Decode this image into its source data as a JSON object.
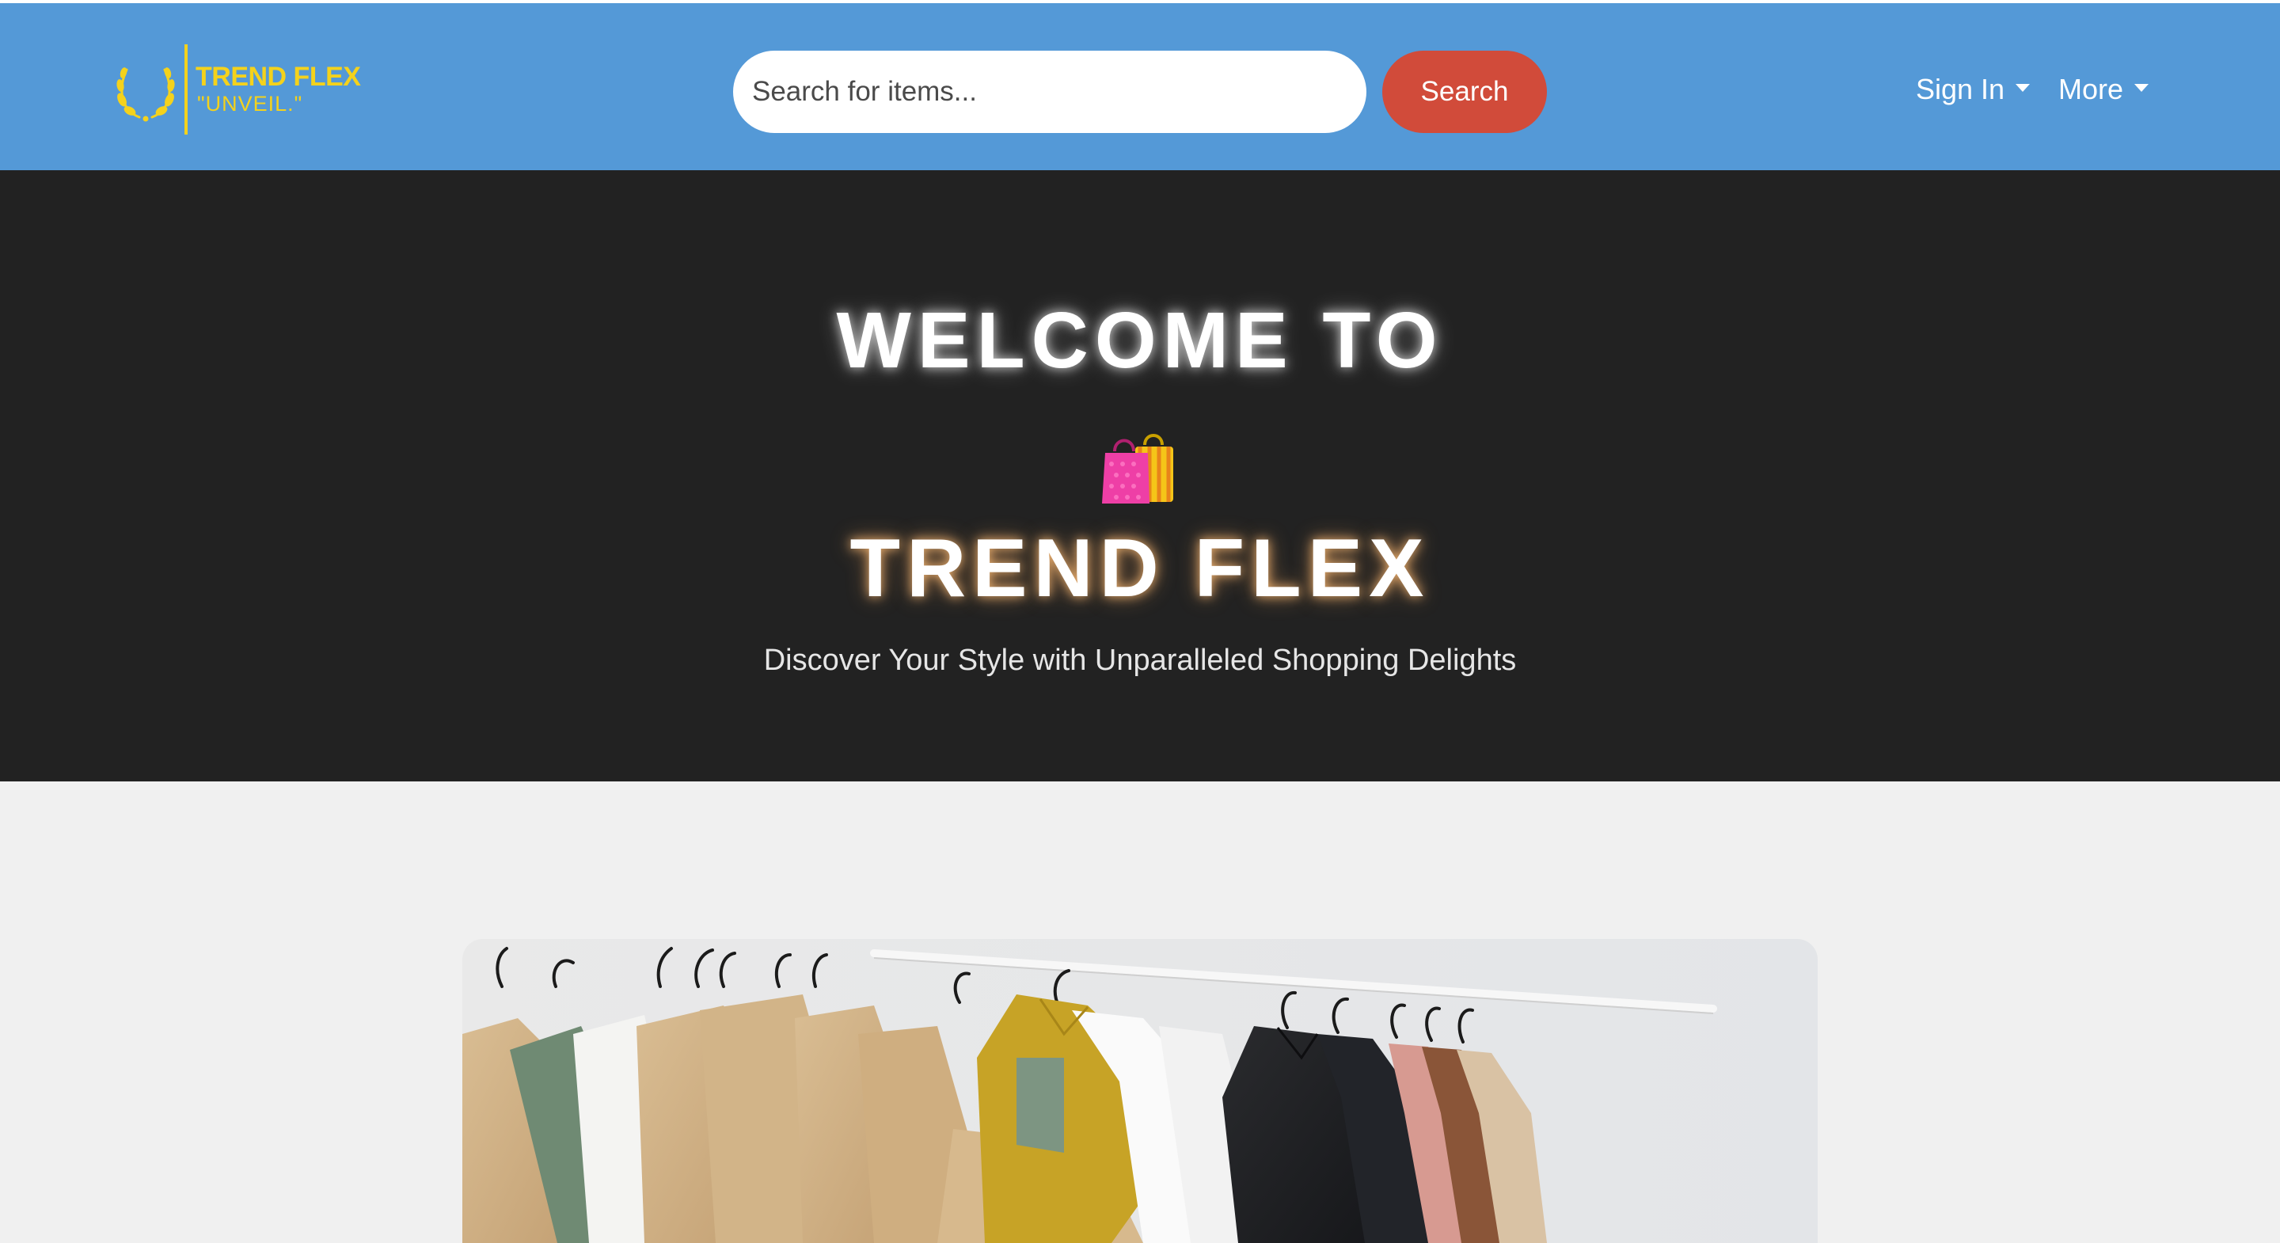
{
  "header": {
    "brand_name": "TREND FLEX",
    "brand_tagline": "\"UNVEIL.\"",
    "logo_icon": "laurel-wreath-icon",
    "search": {
      "placeholder": "Search for items...",
      "value": ""
    },
    "search_button": "Search",
    "menu": {
      "sign_in": "Sign In",
      "more": "More"
    }
  },
  "hero": {
    "line1": "WELCOME TO",
    "icon": "shopping-bags-icon",
    "line2": "TREND FLEX",
    "subtitle": "Discover Your Style with Unparalleled Shopping Delights"
  },
  "colors": {
    "navbar": "#5499d7",
    "brand_yellow": "#f4d21c",
    "search_button": "#d14b3a",
    "hero_bg": "#222222",
    "page_bg": "#f0f0f0"
  }
}
